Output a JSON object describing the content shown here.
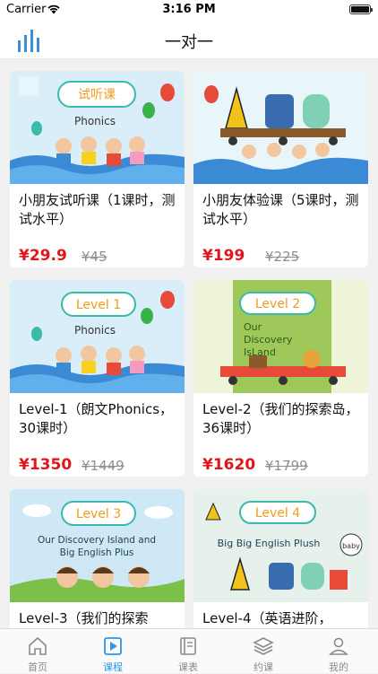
{
  "status": {
    "carrier": "Carrier",
    "time": "3:16 PM"
  },
  "nav": {
    "title": "一对一"
  },
  "colors": {
    "accent": "#2a97e8",
    "price": "#e0161b"
  },
  "cards": [
    {
      "name": "小朋友试听课（1课时，测试水平）",
      "price": "¥29.9",
      "old": "¥45",
      "banner": "试听课",
      "subtitle": "Phonics"
    },
    {
      "name": "小朋友体验课（5课时，测试水平）",
      "price": "¥199",
      "old": "¥225"
    },
    {
      "name": "Level-1（朗文Phonics，30课时）",
      "price": "¥1350",
      "old": "¥1449",
      "banner": "Level 1",
      "subtitle": "Phonics"
    },
    {
      "name": "Level-2（我们的探索岛，36课时）",
      "price": "¥1620",
      "old": "¥1799",
      "banner": "Level 2",
      "subtitle": "Our Discovery IsLand"
    },
    {
      "name": "Level-3（我们的探索",
      "banner": "Level 3",
      "subtitle": "Our Discovery Island and Big English Plus"
    },
    {
      "name": "Level-4（英语进阶，",
      "banner": "Level 4",
      "subtitle": "Big Big English Plush",
      "badge": "baby"
    }
  ],
  "tabs": [
    {
      "label": "首页",
      "icon": "home-icon"
    },
    {
      "label": "课程",
      "icon": "play-icon",
      "active": true
    },
    {
      "label": "课表",
      "icon": "book-icon"
    },
    {
      "label": "约课",
      "icon": "layers-icon"
    },
    {
      "label": "我的",
      "icon": "person-icon"
    }
  ]
}
